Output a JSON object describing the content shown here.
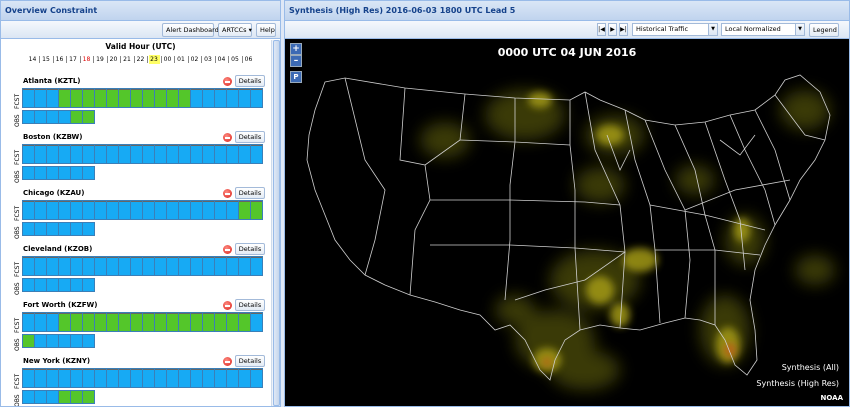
{
  "left_panel": {
    "title": "Overview Constraint",
    "toolbar": {
      "alert_label": "Alert Dashboard",
      "artccs_label": "ARTCCs ▾",
      "help_label": "Help"
    },
    "valid_hour_title": "Valid Hour (UTC)",
    "hours": [
      "14",
      "15",
      "16",
      "17",
      "18",
      "19",
      "20",
      "21",
      "22",
      "23",
      "00",
      "01",
      "02",
      "03",
      "04",
      "05",
      "06"
    ],
    "hour_red_index": 4,
    "hour_highlight_index": 9,
    "details_label": "Details",
    "fcst_label": "FCST",
    "obs_label": "OBS",
    "centers": [
      {
        "name": "Atlanta (KZTL)",
        "fcst": "bbbgggggggggggbbbbbb",
        "obs": "bbbbgg"
      },
      {
        "name": "Boston (KZBW)",
        "fcst": "bbbbbbbbbbbbbbbbbbbb",
        "obs": "bbbbbb"
      },
      {
        "name": "Chicago (KZAU)",
        "fcst": "bbbbbbbbbbbbbbbbbbgg",
        "obs": "bbbbbb"
      },
      {
        "name": "Cleveland (KZOB)",
        "fcst": "bbbbbbbbbbbbbbbbbbbb",
        "obs": "bbbbbb"
      },
      {
        "name": "Fort Worth (KZFW)",
        "fcst": "bbbggggggggggggggggb",
        "obs": "gbbbbb"
      },
      {
        "name": "New York (KZNY)",
        "fcst": "bbbbbbbbbbbbbbbbbbbb",
        "obs": "bbbggg"
      }
    ]
  },
  "right_panel": {
    "title": "Synthesis (High Res) 2016-06-03 1800 UTC Lead 5",
    "nav": {
      "first": "|◀",
      "prev": "▶",
      "last": "▶|"
    },
    "traffic_combo": "Historical Traffic",
    "normalize_combo": "Local Normalized",
    "legend_label": "Legend",
    "map": {
      "time_label": "0000 UTC 04 JUN 2016",
      "zoom_in": "+",
      "zoom_out": "–",
      "pan": "P",
      "legend_line_1": "Synthesis (All)",
      "legend_line_2": "Synthesis (High Res)",
      "credit": "NOAA"
    }
  },
  "colors": {
    "fcst_blue": "#17aaf4",
    "constraint_green": "#54c62a",
    "header_text": "#15428b"
  }
}
